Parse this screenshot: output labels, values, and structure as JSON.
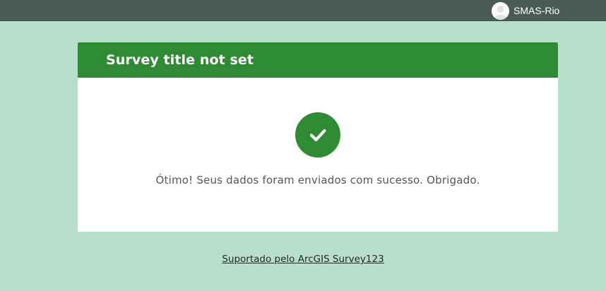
{
  "topbar": {
    "user": {
      "name": "SMAS-Rio",
      "icon": "user-avatar-icon"
    }
  },
  "card": {
    "title": "Survey title not set",
    "status_icon": "check-circle-icon",
    "message": "Ótimo! Seus dados foram enviados com sucesso. Obrigado."
  },
  "footer": {
    "link_text": "Suportado pelo ArcGIS Survey123"
  },
  "colors": {
    "page_background": "#b8dfcb",
    "topbar_background": "#4a5a54",
    "brand_green": "#2e8b34",
    "text_gray": "#555555"
  }
}
